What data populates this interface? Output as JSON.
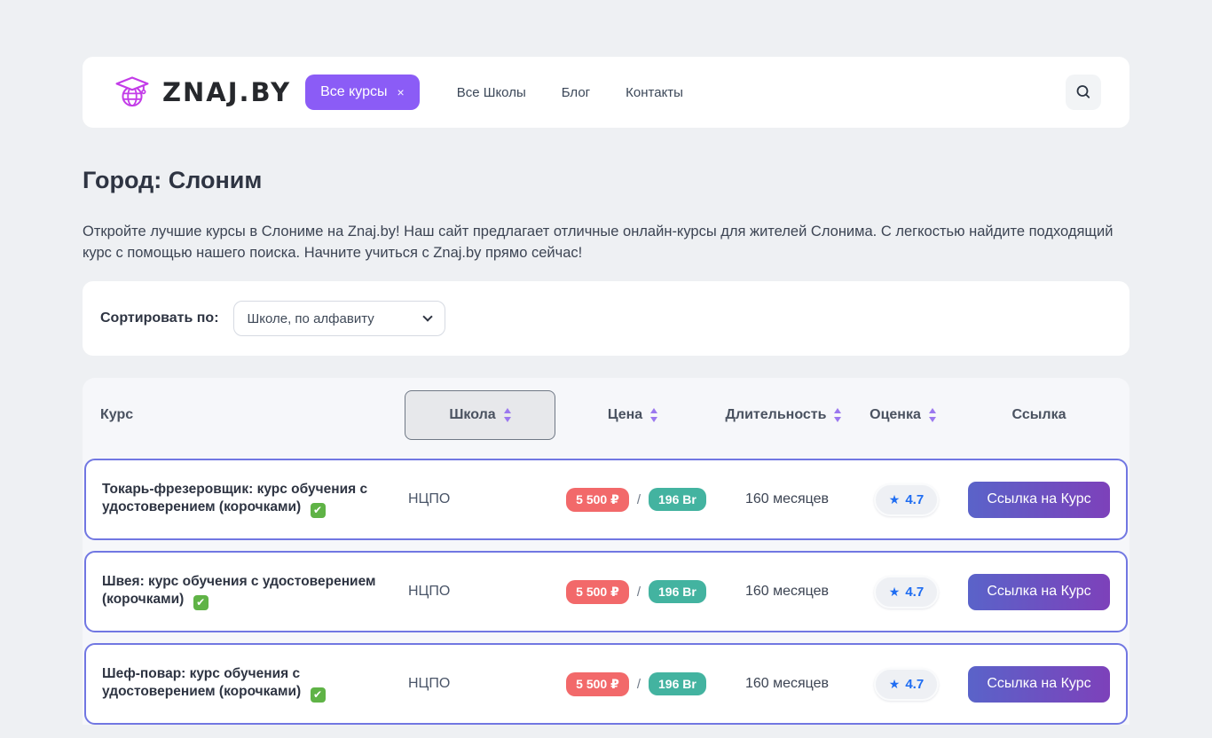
{
  "header": {
    "logo_text": "ZNAJ.BY",
    "all_courses_button": {
      "label": "Все курсы",
      "close": "×"
    },
    "nav": {
      "schools": "Все Школы",
      "blog": "Блог",
      "contacts": "Контакты"
    }
  },
  "main": {
    "title": "Город: Слоним",
    "description": "Откройте лучшие курсы в Слониме на Znaj.by! Наш сайт предлагает отличные онлайн-курсы для жителей Слонима. С легкостью найдите подходящий курс с помощью нашего поиска. Начните учиться с Znaj.by прямо сейчас!",
    "sort": {
      "label": "Сортировать по:",
      "selected_option": "Школе, по алфавиту"
    }
  },
  "table": {
    "columns": {
      "course": "Курс",
      "school": "Школа",
      "price": "Цена",
      "duration": "Длительность",
      "rating": "Оценка",
      "link": "Ссылка"
    },
    "price_separator": "/",
    "check_glyph": "✔",
    "star_glyph": "★",
    "rows": [
      {
        "course": "Токарь-фрезеровщик: курс обучения с удостоверением (корочками)",
        "has_check": true,
        "school": "НЦПО",
        "price_rub": "5 500 ₽",
        "price_br": "196 Br",
        "duration": "160 месяцев",
        "rating": "4.7",
        "link_label": "Ссылка на Курс"
      },
      {
        "course": "Швея: курс обучения с удостоверением (корочками)",
        "has_check": true,
        "school": "НЦПО",
        "price_rub": "5 500 ₽",
        "price_br": "196 Br",
        "duration": "160 месяцев",
        "rating": "4.7",
        "link_label": "Ссылка на Курс"
      },
      {
        "course": "Шеф-повар: курс обучения с удостоверением (корочками)",
        "has_check": true,
        "school": "НЦПО",
        "price_rub": "5 500 ₽",
        "price_br": "196 Br",
        "duration": "160 месяцев",
        "rating": "4.7",
        "link_label": "Ссылка на Курс"
      }
    ]
  },
  "colors": {
    "page-bg": "#eef0f3",
    "accent-purple": "#8b5cf6",
    "row-border": "#7177e2",
    "badge-red": "#f2696a",
    "badge-teal": "#43b3a0",
    "rating-blue": "#1f6df2",
    "logo-magenta": "#c33ce8",
    "btn-grad-a": "#5a63c9",
    "btn-grad-b": "#7d41ba"
  }
}
